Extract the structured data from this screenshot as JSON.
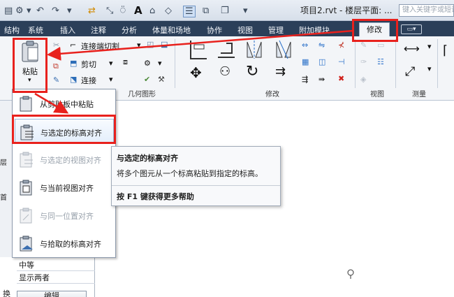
{
  "quick_access": {
    "title": "项目2.rvt - 楼层平面: ...",
    "search_placeholder": "键入关键字或短语"
  },
  "tabs": [
    {
      "label": "结构"
    },
    {
      "label": "系统"
    },
    {
      "label": "插入"
    },
    {
      "label": "注释"
    },
    {
      "label": "分析"
    },
    {
      "label": "体量和场地"
    },
    {
      "label": "协作"
    },
    {
      "label": "视图"
    },
    {
      "label": "管理"
    },
    {
      "label": "附加模块"
    },
    {
      "label": "修改"
    }
  ],
  "ribbon": {
    "paste_label": "粘贴",
    "paste_arrow": "▾",
    "cope_label": "连接端切割",
    "cut_label": "剪切",
    "join_label": "连接",
    "panels": {
      "geometry": "几何图形",
      "modify": "修改",
      "view": "视图",
      "measure": "测量"
    }
  },
  "paste_menu": {
    "items": [
      {
        "label": "从剪贴板中粘贴",
        "enabled": true
      },
      {
        "label": "与选定的标高对齐",
        "enabled": true,
        "highlighted": true
      },
      {
        "label": "与选定的视图对齐",
        "enabled": false
      },
      {
        "label": "与当前视图对齐",
        "enabled": true
      },
      {
        "label": "与同一位置对齐",
        "enabled": false
      },
      {
        "label": "与拾取的标高对齐",
        "enabled": true
      }
    ]
  },
  "tooltip": {
    "title": "与选定的标高对齐",
    "description": "将多个图元从一个标高粘贴到指定的标高。",
    "help": "按 F1 键获得更多帮助"
  },
  "left_panel": {
    "label_1": "层",
    "label_2": "首",
    "row_1": "中等",
    "row_2": "显示两者",
    "row_3_label": "换",
    "edit_button": "编辑"
  },
  "colors": {
    "highlight_red": "#e8211d",
    "tab_bar": "#2b3f59",
    "ribbon_bg": "#f3f5f8"
  }
}
